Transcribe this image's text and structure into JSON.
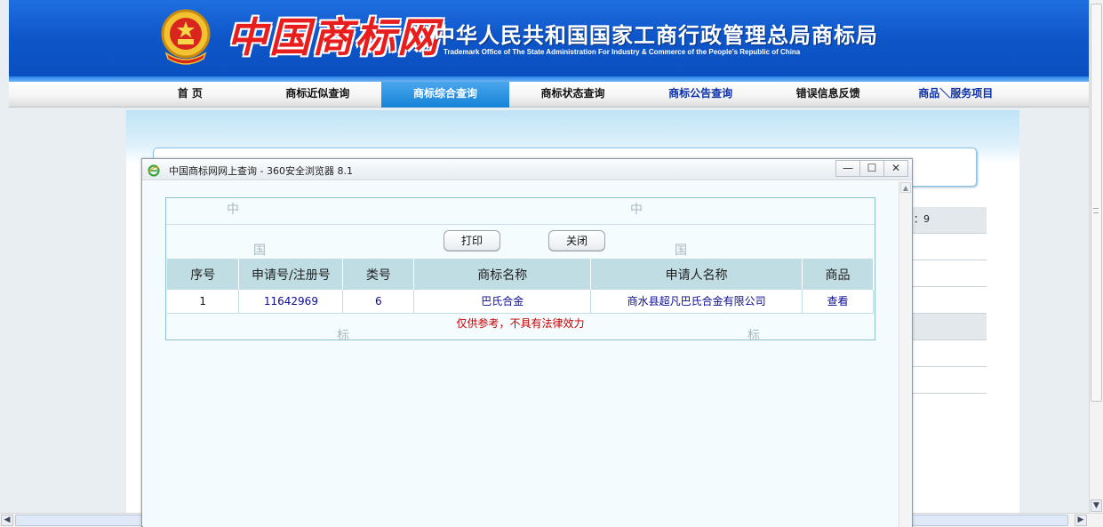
{
  "header": {
    "logo_text": "中国商标网",
    "org_name_cn": "中华人民共和国国家工商行政管理总局商标局",
    "org_name_en": "Trademark Office of The State Administration For Industry & Commerce of the People’s Republic of China"
  },
  "nav": {
    "items": [
      {
        "label": "首  页"
      },
      {
        "label": "商标近似查询"
      },
      {
        "label": "商标综合查询"
      },
      {
        "label": "商标状态查询"
      },
      {
        "label": "商标公告查询"
      },
      {
        "label": "错误信息反馈"
      },
      {
        "label": "商品＼服务项目"
      }
    ],
    "active_index": 2
  },
  "background": {
    "side_value": "：9"
  },
  "popup": {
    "title": "中国商标网网上查询 - 360安全浏览器 8.1",
    "window_buttons": {
      "minimize": "—",
      "maximize": "☐",
      "close": "✕"
    },
    "print_label": "打印",
    "close_label": "关闭",
    "watermarks": {
      "a": "中",
      "b": "国",
      "c": "标"
    },
    "table": {
      "headers": [
        "序号",
        "申请号/注册号",
        "类号",
        "商标名称",
        "申请人名称",
        "商品"
      ],
      "rows": [
        {
          "index": "1",
          "reg_no": "11642969",
          "class": "6",
          "mark_name": "巴氏合金",
          "applicant": "商水县超凡巴氏合金有限公司",
          "goods": "查看"
        }
      ]
    },
    "disclaimer": "仅供参考，不具有法律效力"
  },
  "colors": {
    "banner": "#0e56c9",
    "nav_active": "#1583d8",
    "table_header": "#c0dde3",
    "link": "#0a0a8f",
    "warning": "#c40000"
  }
}
